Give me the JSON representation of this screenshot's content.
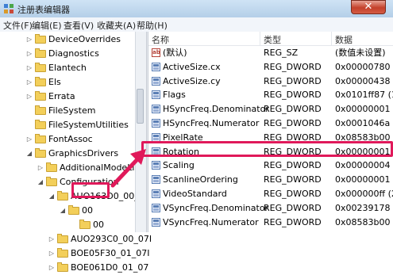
{
  "window": {
    "title": "注册表编辑器",
    "close_glyph": "✕"
  },
  "menu": [
    "文件(F)",
    "编辑(E)",
    "查看(V)",
    "收藏夹(A)",
    "帮助(H)"
  ],
  "tree": [
    {
      "label": "DeviceOverrides",
      "depth": 0,
      "exp": "▷"
    },
    {
      "label": "Diagnostics",
      "depth": 0,
      "exp": "▷"
    },
    {
      "label": "Elantech",
      "depth": 0,
      "exp": "▷"
    },
    {
      "label": "Els",
      "depth": 0,
      "exp": "▷"
    },
    {
      "label": "Errata",
      "depth": 0,
      "exp": "▷"
    },
    {
      "label": "FileSystem",
      "depth": 0,
      "exp": ""
    },
    {
      "label": "FileSystemUtilities",
      "depth": 0,
      "exp": ""
    },
    {
      "label": "FontAssoc",
      "depth": 0,
      "exp": "▷"
    },
    {
      "label": "GraphicsDrivers",
      "depth": 0,
      "exp": "◢"
    },
    {
      "label": "AdditionalModeLists",
      "depth": 1,
      "exp": "▷"
    },
    {
      "label": "Configuration",
      "depth": 1,
      "exp": "◢"
    },
    {
      "label": "AUO163D0_00_",
      "depth": 2,
      "exp": "◢"
    },
    {
      "label": "00",
      "depth": 3,
      "exp": "◢"
    },
    {
      "label": "00",
      "depth": 4,
      "exp": ""
    },
    {
      "label": "AUO293C0_00_07I",
      "depth": 2,
      "exp": "▷"
    },
    {
      "label": "BOE05F30_01_07I",
      "depth": 2,
      "exp": "▷"
    },
    {
      "label": "BOE061D0_01_07",
      "depth": 2,
      "exp": "▷"
    }
  ],
  "columns": {
    "name": "名称",
    "type": "类型",
    "data": "数据"
  },
  "values": [
    {
      "name": "(默认)",
      "type": "REG_SZ",
      "data": "(数值未设置)",
      "kind": "sz"
    },
    {
      "name": "ActiveSize.cx",
      "type": "REG_DWORD",
      "data": "0x00000780 (19",
      "kind": "dw"
    },
    {
      "name": "ActiveSize.cy",
      "type": "REG_DWORD",
      "data": "0x00000438 (10",
      "kind": "dw"
    },
    {
      "name": "Flags",
      "type": "REG_DWORD",
      "data": "0x0101ff87 (169",
      "kind": "dw"
    },
    {
      "name": "HSyncFreq.Denominator",
      "type": "REG_DWORD",
      "data": "0x00000001 (1)",
      "kind": "dw"
    },
    {
      "name": "HSyncFreq.Numerator",
      "type": "REG_DWORD",
      "data": "0x0001046a (66",
      "kind": "dw"
    },
    {
      "name": "PixelRate",
      "type": "REG_DWORD",
      "data": "0x08583b00 (14",
      "kind": "dw"
    },
    {
      "name": "Rotation",
      "type": "REG_DWORD",
      "data": "0x00000001 (1)",
      "kind": "dw"
    },
    {
      "name": "Scaling",
      "type": "REG_DWORD",
      "data": "0x00000004 (4)",
      "kind": "dw"
    },
    {
      "name": "ScanlineOrdering",
      "type": "REG_DWORD",
      "data": "0x00000001 (1)",
      "kind": "dw"
    },
    {
      "name": "VideoStandard",
      "type": "REG_DWORD",
      "data": "0x000000ff (255",
      "kind": "dw"
    },
    {
      "name": "VSyncFreq.Denominator",
      "type": "REG_DWORD",
      "data": "0x00239178 (23",
      "kind": "dw"
    },
    {
      "name": "VSyncFreq.Numerator",
      "type": "REG_DWORD",
      "data": "0x08583b00 (14",
      "kind": "dw"
    }
  ],
  "colors": {
    "highlight": "#e0195a",
    "folder": "#f3cf5a",
    "titlebar": "#b4cfe8"
  },
  "icons": {
    "value_sz": "string-value-icon",
    "value_dword": "dword-value-icon",
    "folder": "folder-icon"
  }
}
